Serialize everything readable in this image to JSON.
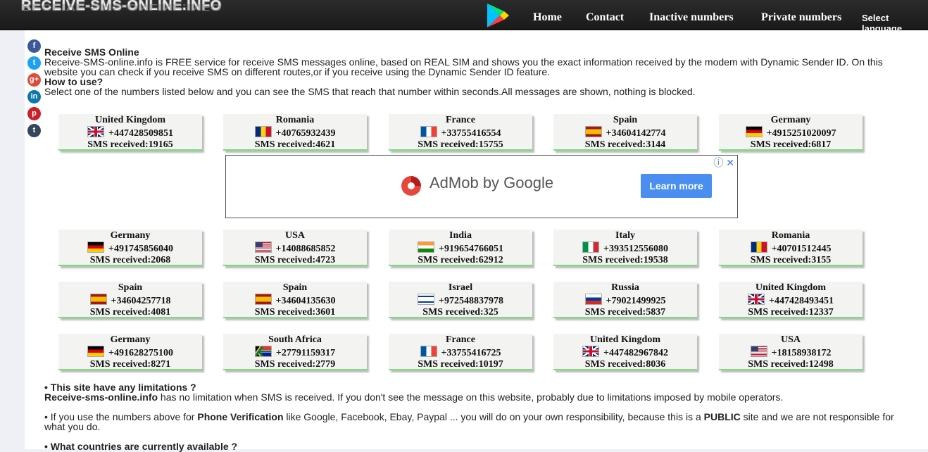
{
  "header": {
    "logo_text": "RECEIVE-SMS-ONLINE.INFO",
    "nav": [
      "Home",
      "Contact",
      "Inactive numbers",
      "Private numbers"
    ],
    "language_label": "Select language"
  },
  "social": [
    {
      "icon": "facebook-icon",
      "glyph": "f",
      "color": "#3b5998"
    },
    {
      "icon": "twitter-icon",
      "glyph": "t",
      "color": "#1da1f2"
    },
    {
      "icon": "google-plus-icon",
      "glyph": "g+",
      "color": "#dd4b39"
    },
    {
      "icon": "linkedin-icon",
      "glyph": "in",
      "color": "#0e76a8"
    },
    {
      "icon": "pinterest-icon",
      "glyph": "p",
      "color": "#cb2027"
    },
    {
      "icon": "tumblr-icon",
      "glyph": "t",
      "color": "#35465c"
    }
  ],
  "intro": {
    "title": "Receive SMS Online",
    "desc": "Receive-SMS-online.info is FREE service for receive SMS messages online, based on REAL SIM and shows you the exact information received by the modem with Dynamic Sender ID. On this website you can check if you receive SMS on different routes,or if you receive using the Dynamic Sender ID feature.",
    "howto_title": "How to use?",
    "howto_desc": "Select one of the numbers listed below and you can see the SMS that reach that number within seconds.All messages are shown, nothing is blocked."
  },
  "numbers": [
    {
      "country": "United Kingdom",
      "flag": "uk",
      "number": "+447428509851",
      "sms": "SMS received:19165"
    },
    {
      "country": "Romania",
      "flag": "ro",
      "number": "+40765932439",
      "sms": "SMS received:4621"
    },
    {
      "country": "France",
      "flag": "fr",
      "number": "+33755416554",
      "sms": "SMS received:15755"
    },
    {
      "country": "Spain",
      "flag": "es",
      "number": "+34604142774",
      "sms": "SMS received:3144"
    },
    {
      "country": "Germany",
      "flag": "de",
      "number": "+4915251020097",
      "sms": "SMS received:6817"
    },
    {
      "country": "Germany",
      "flag": "de",
      "number": "+491745856040",
      "sms": "SMS received:2068"
    },
    {
      "country": "USA",
      "flag": "us",
      "number": "+14088685852",
      "sms": "SMS received:4723"
    },
    {
      "country": "India",
      "flag": "in",
      "number": "+919654766051",
      "sms": "SMS received:62912"
    },
    {
      "country": "Italy",
      "flag": "it",
      "number": "+393512556080",
      "sms": "SMS received:19538"
    },
    {
      "country": "Romania",
      "flag": "ro",
      "number": "+40701512445",
      "sms": "SMS received:3155"
    },
    {
      "country": "Spain",
      "flag": "es",
      "number": "+34604257718",
      "sms": "SMS received:4081"
    },
    {
      "country": "Spain",
      "flag": "es",
      "number": "+34604135630",
      "sms": "SMS received:3601"
    },
    {
      "country": "Israel",
      "flag": "il",
      "number": "+972548837978",
      "sms": "SMS received:325"
    },
    {
      "country": "Russia",
      "flag": "ru",
      "number": "+79021499925",
      "sms": "SMS received:5837"
    },
    {
      "country": "United Kingdom",
      "flag": "uk",
      "number": "+447428493451",
      "sms": "SMS received:12337"
    },
    {
      "country": "Germany",
      "flag": "de",
      "number": "+491628275100",
      "sms": "SMS received:8271"
    },
    {
      "country": "South Africa",
      "flag": "za",
      "number": "+27791159317",
      "sms": "SMS received:2779"
    },
    {
      "country": "France",
      "flag": "fr",
      "number": "+33755416725",
      "sms": "SMS received:10197"
    },
    {
      "country": "United Kingdom",
      "flag": "uk",
      "number": "+447482967842",
      "sms": "SMS received:8036"
    },
    {
      "country": "USA",
      "flag": "us",
      "number": "+18158938172",
      "sms": "SMS received:12498"
    }
  ],
  "ad": {
    "brand": "AdMob by Google",
    "button": "Learn more",
    "ad_choices": "ⓘ ✕"
  },
  "bottom": {
    "q1": "• This site have any limitations ?",
    "a1_strong": "Receive-sms-online.info",
    "a1_rest": " has no limitation when SMS is received. If you don't see the message on this website, probably due to limitations imposed by mobile operators.",
    "p2_start": "• If you use the numbers above for ",
    "p2_strong1": "Phone Verification",
    "p2_mid": " like Google, Facebook, Ebay, Paypal ... you will do on your own responsibility, because this is a ",
    "p2_strong2": "PUBLIC",
    "p2_end": " site and we are not responsible for what you do.",
    "q3": "• What countries are currently available ?"
  }
}
